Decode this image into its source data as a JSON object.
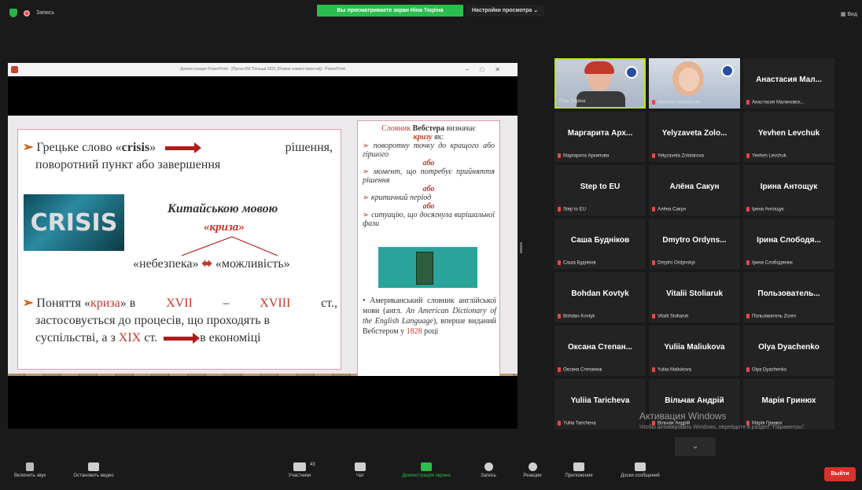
{
  "top": {
    "recording_label": "Запись",
    "banner": "Вы просматриваете экран Ніна Тюріна",
    "view_options": "Настройки просмотра",
    "view_mode": "Вид"
  },
  "ppt": {
    "title": "Демонстрация PowerPoint - [Преза КМ Польща 2021 [Режим совместимости]] - PowerPoint"
  },
  "slide": {
    "p1_a": "Грецьке слово «",
    "p1_crisis": "crisis",
    "p1_b": "»",
    "p1_c": "рішення,",
    "p1_d": "поворотний пункт або завершення",
    "crisis_img_text": "CRISIS",
    "kit_title": "Китайською мовою",
    "kryza": "«криза»",
    "danger": "«небезпека»",
    "chance": "«можливість»",
    "p3_a": "Поняття «",
    "p3_kryza": "криза",
    "p3_b": "» в",
    "p3_c17": "XVII",
    "p3_dash": "–",
    "p3_c18": "XVIII",
    "p3_st": "ст.,",
    "p3_line2": "застосовується до процесів, що проходять в",
    "p3_line3a": "суспільстві, а з",
    "p3_c19": "XIX",
    "p3_line3b": "ст.",
    "p3_line3c": "в економіці",
    "r_head_a": "Словник",
    "r_head_b": "Вебстера",
    "r_head_c": "визначає",
    "r_krizu": "кризу",
    "r_yak": "як:",
    "r_b1": "поворотну точку до кращого або гіршого",
    "r_abo": "або",
    "r_b2": "момент, що потребує прийняття рішення",
    "r_b3": "критичний період",
    "r_b4": "ситуацію, що досягнула вирішальної фази",
    "r_b5_a": "Американський словник англійської мови (англ.",
    "r_b5_b": "An American Dictionary of the English Language",
    "r_b5_c": "), вперше виданий Вебстером у",
    "r_year": "1828",
    "r_b5_d": "році"
  },
  "gallery": [
    {
      "name": "",
      "label": "Ніна Тюріна",
      "video": true
    },
    {
      "name": "",
      "label": "Наталія Гавловська",
      "video": true
    },
    {
      "name": "Анастасия Мал...",
      "label": "Анастасия Малиновск..."
    },
    {
      "name": "Маргарита Арх...",
      "label": "Маргарита Архипова"
    },
    {
      "name": "Yelyzaveta Zolo...",
      "label": "Yelyzaveta Zolotarova"
    },
    {
      "name": "Yevhen Levchuk",
      "label": "Yevhen Levchuk"
    },
    {
      "name": "Step to EU",
      "label": "Step to EU"
    },
    {
      "name": "Алёна Сакун",
      "label": "Алёна Сакун"
    },
    {
      "name": "Ірина Антощук",
      "label": "Ірина Антощук"
    },
    {
      "name": "Саша Будніков",
      "label": "Саша Будніков"
    },
    {
      "name": "Dmytro Ordyns...",
      "label": "Dmytro Ordynskyi"
    },
    {
      "name": "Ірина Слободя...",
      "label": "Ірина Слободянюк"
    },
    {
      "name": "Bohdan Kovtyk",
      "label": "Bohdan Kovtyk"
    },
    {
      "name": "Vitalii Stoliaruk",
      "label": "Vitalii Stoliaruk"
    },
    {
      "name": "Пользователь...",
      "label": "Пользователь Zoom"
    },
    {
      "name": "Оксана Степан...",
      "label": "Оксана Степанюк"
    },
    {
      "name": "Yuliia Maliukova",
      "label": "Yuliia Maliukova"
    },
    {
      "name": "Olya Dyachenko",
      "label": "Olya Dyachenko"
    },
    {
      "name": "Yuliia Taricheva",
      "label": "Yuliia Taricheva"
    },
    {
      "name": "Вільчак Андрій",
      "label": "Вільчак Андрій"
    },
    {
      "name": "Марія Гринюх",
      "label": "Марія Гринюх"
    }
  ],
  "watermark": {
    "line1": "Активация Windows",
    "line2": "Чтобы активировать Windows, перейдите в раздел \"Параметры\"."
  },
  "bottom": {
    "mic": "Включить звук",
    "video": "Остановить видео",
    "participants": "Участники",
    "participants_count": "43",
    "chat": "Чат",
    "share": "Демонстрация экрана",
    "record": "Запись",
    "reactions": "Реакции",
    "apps": "Приложения",
    "whiteboards": "Доски сообщений",
    "leave": "Выйти"
  }
}
